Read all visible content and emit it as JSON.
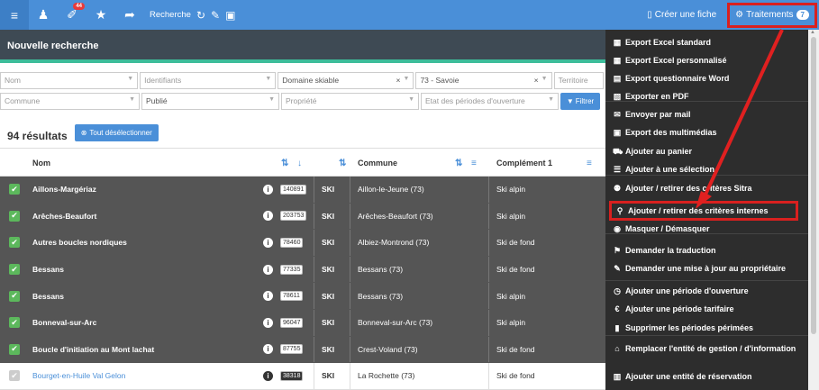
{
  "topbar": {
    "notif_badge": "44",
    "search_label": "Recherche",
    "create_label": "Créer une fiche",
    "traitements_label": "Traitements",
    "traitements_count": "7"
  },
  "page_title": "Nouvelle recherche",
  "filters": {
    "row1": [
      {
        "text": "Nom",
        "placeholder": true
      },
      {
        "text": "Identifiants",
        "placeholder": true
      },
      {
        "text": "Domaine skiable",
        "placeholder": false,
        "clear": true
      },
      {
        "text": "73 - Savoie",
        "placeholder": false,
        "clear": true
      },
      {
        "text": "Territoire",
        "placeholder": true
      }
    ],
    "row2": [
      {
        "text": "Commune",
        "placeholder": true
      },
      {
        "text": "Publié",
        "placeholder": false
      },
      {
        "text": "Propriété",
        "placeholder": true
      },
      {
        "text": "Etat des périodes d'ouverture",
        "placeholder": true
      }
    ],
    "filter_button": "Filtrer"
  },
  "results": {
    "count_label": "94 résultats",
    "deselect_label": "Tout désélectionner"
  },
  "table": {
    "headers": {
      "name": "Nom",
      "commune": "Commune",
      "complement": "Complément 1"
    },
    "rows": [
      {
        "name": "Aillons-Margériaz",
        "id": "140891",
        "type": "SKI",
        "commune": "Aillon-le-Jeune (73)",
        "complement": "Ski alpin",
        "selected": true
      },
      {
        "name": "Arêches-Beaufort",
        "id": "203753",
        "type": "SKI",
        "commune": "Arêches-Beaufort (73)",
        "complement": "Ski alpin",
        "selected": true
      },
      {
        "name": "Autres boucles nordiques",
        "id": "78460",
        "type": "SKI",
        "commune": "Albiez-Montrond (73)",
        "complement": "Ski de fond",
        "selected": true
      },
      {
        "name": "Bessans",
        "id": "77335",
        "type": "SKI",
        "commune": "Bessans (73)",
        "complement": "Ski de fond",
        "selected": true
      },
      {
        "name": "Bessans",
        "id": "78611",
        "type": "SKI",
        "commune": "Bessans (73)",
        "complement": "Ski alpin",
        "selected": true
      },
      {
        "name": "Bonneval-sur-Arc",
        "id": "96047",
        "type": "SKI",
        "commune": "Bonneval-sur-Arc (73)",
        "complement": "Ski alpin",
        "selected": true
      },
      {
        "name": "Boucle d'initiation au Mont lachat",
        "id": "87755",
        "type": "SKI",
        "commune": "Crest-Voland (73)",
        "complement": "Ski de fond",
        "selected": true
      },
      {
        "name": "Bourget-en-Huile Val Gelon",
        "id": "38318",
        "type": "SKI",
        "commune": "La Rochette (73)",
        "complement": "Ski de fond",
        "selected": false
      }
    ]
  },
  "menu": {
    "items": [
      {
        "icon": "▦",
        "icon_name": "grid-icon",
        "label": "Export Excel standard"
      },
      {
        "icon": "▦",
        "icon_name": "grid-icon",
        "label": "Export Excel personnalisé"
      },
      {
        "icon": "▤",
        "icon_name": "word-file-icon",
        "label": "Export questionnaire Word"
      },
      {
        "icon": "▧",
        "icon_name": "pdf-file-icon",
        "label": "Exporter en PDF"
      },
      {
        "icon": "✉",
        "icon_name": "envelope-icon",
        "label": "Envoyer par mail"
      },
      {
        "icon": "▣",
        "icon_name": "image-icon",
        "label": "Export des multimédias"
      },
      {
        "icon": "⛟",
        "icon_name": "cart-icon",
        "label": "Ajouter au panier"
      },
      {
        "icon": "☰",
        "icon_name": "list-icon",
        "label": "Ajouter à une sélection"
      },
      {
        "icon": "⚉",
        "icon_name": "sitemap-icon",
        "label": "Ajouter / retirer des critères Sitra"
      },
      {
        "icon": "⚲",
        "icon_name": "pin-icon",
        "label": "Ajouter / retirer des critères internes"
      },
      {
        "icon": "◉",
        "icon_name": "eye-icon",
        "label": "Masquer / Démasquer"
      },
      {
        "icon": "⚑",
        "icon_name": "flag-icon",
        "label": "Demander la traduction"
      },
      {
        "icon": "✎",
        "icon_name": "edit-icon",
        "label": "Demander une mise à jour au propriétaire"
      },
      {
        "icon": "◷",
        "icon_name": "clock-icon",
        "label": "Ajouter une période d'ouverture"
      },
      {
        "icon": "€",
        "icon_name": "euro-icon",
        "label": "Ajouter une période tarifaire"
      },
      {
        "icon": "▮",
        "icon_name": "trash-icon",
        "label": "Supprimer les périodes périmées"
      },
      {
        "icon": "⌂",
        "icon_name": "home-icon",
        "label": "Remplacer l'entité de gestion / d'information"
      },
      {
        "icon": "▥",
        "icon_name": "building-icon",
        "label": "Ajouter une entité de réservation"
      }
    ]
  },
  "colors": {
    "topbar": "#4a8fd8",
    "menu_bg": "#2d2d2d",
    "highlight": "#d9201f",
    "row_dark": "#555555",
    "checkbox": "#5cb85c"
  }
}
